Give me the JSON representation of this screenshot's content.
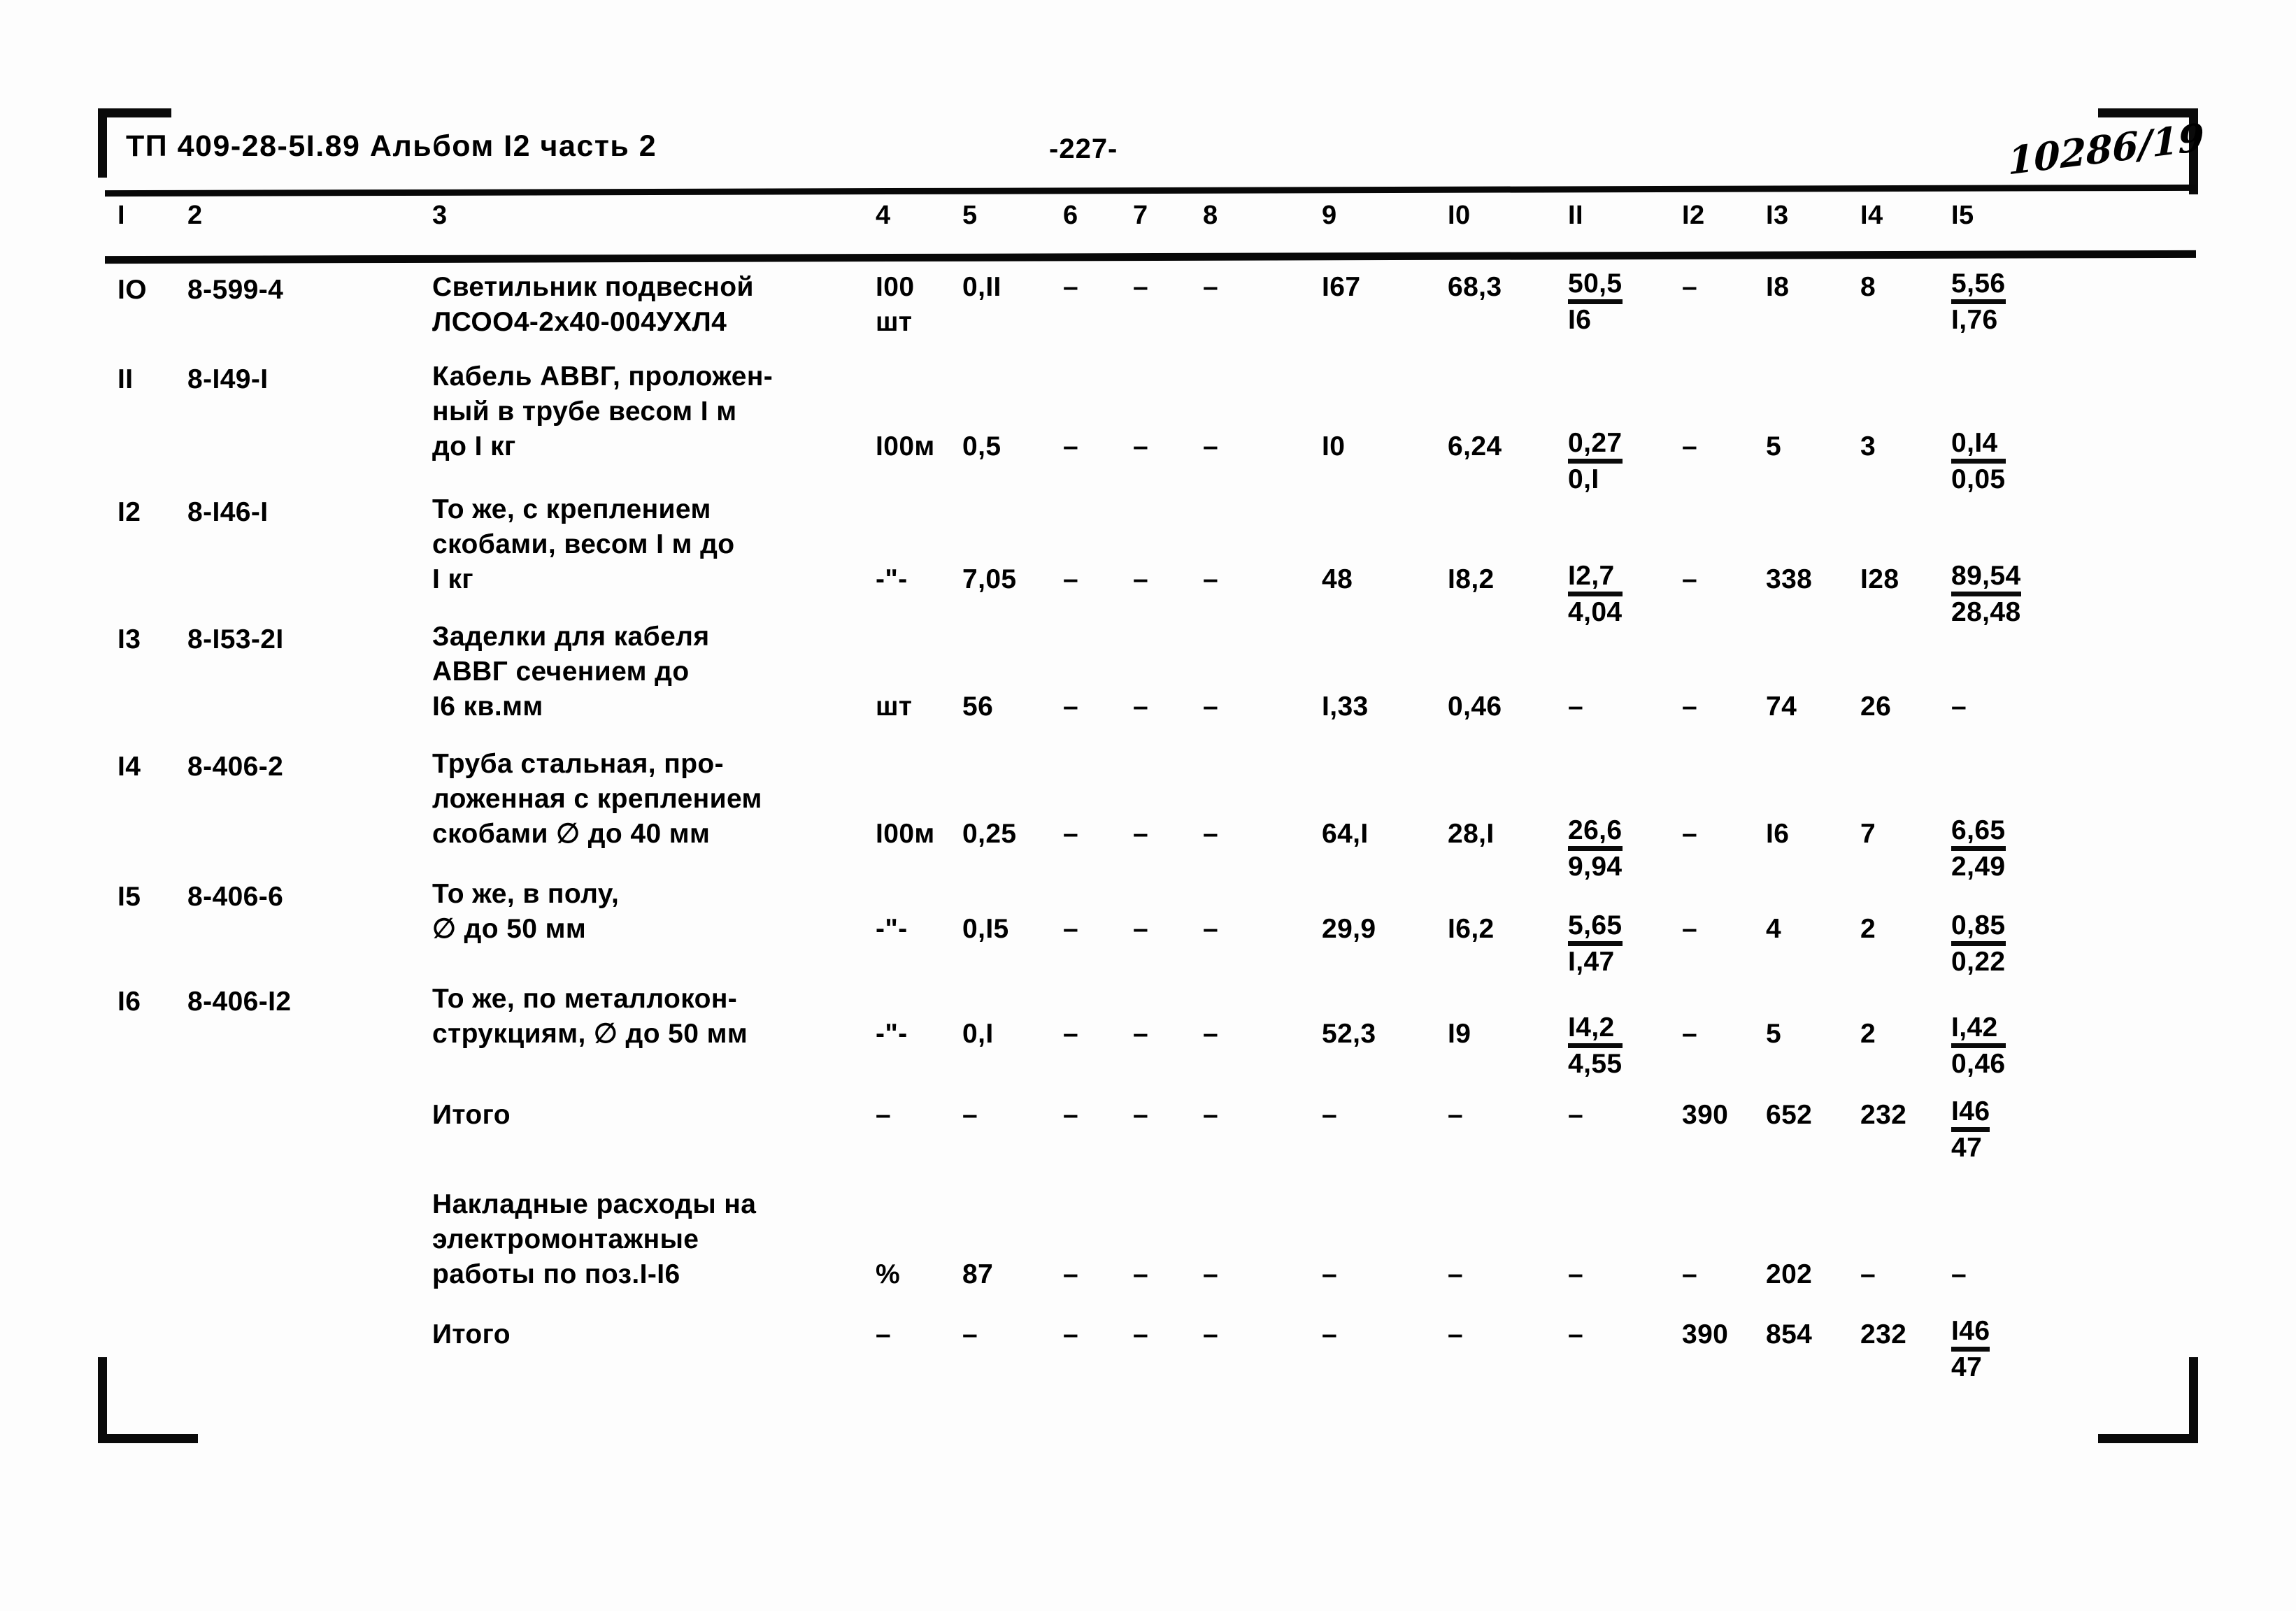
{
  "header": {
    "code": "ТП 409-28-5I.89 Альбом I2 часть 2",
    "page_number": "-227-",
    "stamp": "10286/19"
  },
  "column_headers": [
    "I",
    "2",
    "3",
    "4",
    "5",
    "6",
    "7",
    "8",
    "9",
    "I0",
    "II",
    "I2",
    "I3",
    "I4",
    "I5"
  ],
  "rows": [
    {
      "n": "IO",
      "code": "8-599-4",
      "desc_lines": [
        "Светильник подвесной",
        "ЛСОО4-2х40-004УХЛ4"
      ],
      "unit": "I00",
      "unit2": "шт",
      "qty": "0,II",
      "c6": "–",
      "c7": "–",
      "c8": "–",
      "c9": "I67",
      "c10": "68,3",
      "c11_num": "50,5",
      "c11_den": "I6",
      "c12": "–",
      "c13": "I8",
      "c14": "8",
      "c15_num": "5,56",
      "c15_den": "I,76"
    },
    {
      "n": "II",
      "code": "8-I49-I",
      "desc_lines": [
        "Кабель АВВГ, проложен-",
        "ный в трубе весом I м",
        "до I кг"
      ],
      "unit": "I00м",
      "unit2": "",
      "qty": "0,5",
      "c6": "–",
      "c7": "–",
      "c8": "–",
      "c9": "I0",
      "c10": "6,24",
      "c11_num": "0,27",
      "c11_den": "0,I",
      "c12": "–",
      "c13": "5",
      "c14": "3",
      "c15_num": "0,I4",
      "c15_den": "0,05"
    },
    {
      "n": "I2",
      "code": "8-I46-I",
      "desc_lines": [
        "То же, с креплением",
        "скобами, весом I м до",
        "I кг"
      ],
      "unit": "-\"-",
      "unit2": "",
      "qty": "7,05",
      "c6": "–",
      "c7": "–",
      "c8": "–",
      "c9": "48",
      "c10": "I8,2",
      "c11_num": "I2,7",
      "c11_den": "4,04",
      "c12": "–",
      "c13": "338",
      "c14": "I28",
      "c15_num": "89,54",
      "c15_den": "28,48"
    },
    {
      "n": "I3",
      "code": "8-I53-2I",
      "desc_lines": [
        "Заделки для кабеля",
        "АВВГ сечением до",
        "I6 кв.мм"
      ],
      "unit": "шт",
      "unit2": "",
      "qty": "56",
      "c6": "–",
      "c7": "–",
      "c8": "–",
      "c9": "I,33",
      "c10": "0,46",
      "c11_num": "–",
      "c11_den": "",
      "c12": "–",
      "c13": "74",
      "c14": "26",
      "c15_num": "–",
      "c15_den": ""
    },
    {
      "n": "I4",
      "code": "8-406-2",
      "desc_lines": [
        "Труба стальная, про-",
        "ложенная с креплением",
        "скобами ∅ до 40 мм"
      ],
      "unit": "I00м",
      "unit2": "",
      "qty": "0,25",
      "c6": "–",
      "c7": "–",
      "c8": "–",
      "c9": "64,I",
      "c10": "28,I",
      "c11_num": "26,6",
      "c11_den": "9,94",
      "c12": "–",
      "c13": "I6",
      "c14": "7",
      "c15_num": "6,65",
      "c15_den": "2,49"
    },
    {
      "n": "I5",
      "code": "8-406-6",
      "desc_lines": [
        "То же, в полу,",
        "∅ до 50 мм"
      ],
      "unit": "-\"-",
      "unit2": "",
      "qty": "0,I5",
      "c6": "–",
      "c7": "–",
      "c8": "–",
      "c9": "29,9",
      "c10": "I6,2",
      "c11_num": "5,65",
      "c11_den": "I,47",
      "c12": "–",
      "c13": "4",
      "c14": "2",
      "c15_num": "0,85",
      "c15_den": "0,22"
    },
    {
      "n": "I6",
      "code": "8-406-I2",
      "desc_lines": [
        "То же, по металлокон-",
        "струкциям, ∅ до 50 мм"
      ],
      "unit": "-\"-",
      "unit2": "",
      "qty": "0,I",
      "c6": "–",
      "c7": "–",
      "c8": "–",
      "c9": "52,3",
      "c10": "I9",
      "c11_num": "I4,2",
      "c11_den": "4,55",
      "c12": "–",
      "c13": "5",
      "c14": "2",
      "c15_num": "I,42",
      "c15_den": "0,46"
    }
  ],
  "totals": {
    "itogo1": {
      "label": "Итого",
      "c4": "–",
      "c5": "–",
      "c6": "–",
      "c7": "–",
      "c8": "–",
      "c9": "–",
      "c10": "–",
      "c11": "–",
      "c12": "390",
      "c13": "652",
      "c14": "232",
      "c15_num": "I46",
      "c15_den": "47"
    },
    "overhead": {
      "label_lines": [
        "Накладные расходы на",
        "электромонтажные",
        "работы по поз.I-I6"
      ],
      "c4": "%",
      "c5": "87",
      "c6": "–",
      "c7": "–",
      "c8": "–",
      "c9": "–",
      "c10": "–",
      "c11": "–",
      "c12": "–",
      "c13": "202",
      "c14": "–",
      "c15": "–"
    },
    "itogo2": {
      "label": "Итого",
      "c4": "–",
      "c5": "–",
      "c6": "–",
      "c7": "–",
      "c8": "–",
      "c9": "–",
      "c10": "–",
      "c11": "–",
      "c12": "390",
      "c13": "854",
      "c14": "232",
      "c15_num": "I46",
      "c15_den": "47"
    }
  }
}
